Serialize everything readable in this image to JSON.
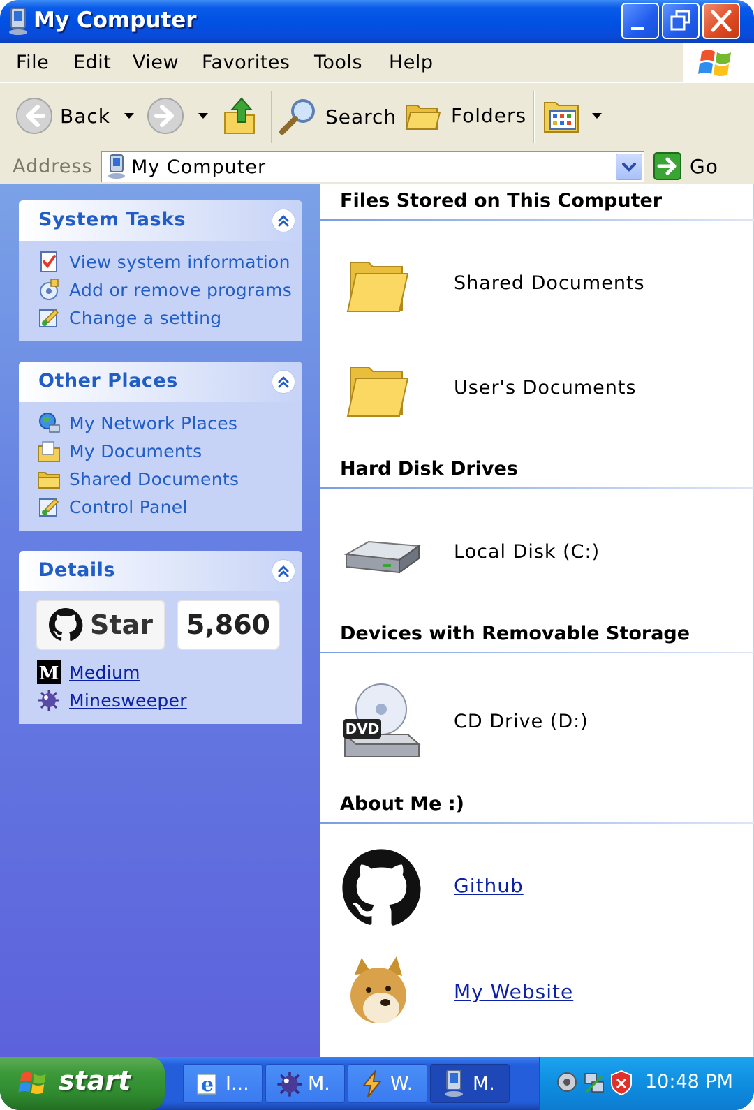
{
  "window": {
    "title": "My Computer",
    "icon": "my-computer-icon",
    "controls": [
      "minimize-icon",
      "restore-icon",
      "close-icon"
    ]
  },
  "menubar": {
    "items": [
      "File",
      "Edit",
      "View",
      "Favorites",
      "Tools",
      "Help"
    ],
    "logo": "windows-flag-logo"
  },
  "toolbar": {
    "back_label": "Back",
    "search_label": "Search",
    "folders_label": "Folders",
    "icons": [
      "back-arrow-icon",
      "forward-arrow-icon",
      "up-folder-icon",
      "search-magnifier-icon",
      "folders-icon",
      "views-icon"
    ]
  },
  "address": {
    "label": "Address",
    "value": "My Computer",
    "go_label": "Go"
  },
  "sidebar": {
    "system_tasks": {
      "title": "System Tasks",
      "items": [
        {
          "label": "View system information",
          "icon": "system-info-icon"
        },
        {
          "label": "Add or remove programs",
          "icon": "add-remove-programs-icon"
        },
        {
          "label": "Change a setting",
          "icon": "control-panel-icon"
        }
      ]
    },
    "other_places": {
      "title": "Other Places",
      "items": [
        {
          "label": "My Network Places",
          "icon": "network-places-icon"
        },
        {
          "label": "My Documents",
          "icon": "my-documents-icon"
        },
        {
          "label": "Shared Documents",
          "icon": "folder-icon"
        },
        {
          "label": "Control Panel",
          "icon": "control-panel-icon"
        }
      ]
    },
    "details": {
      "title": "Details",
      "star_label": "Star",
      "star_count": "5,860",
      "links": [
        {
          "label": "Medium",
          "icon": "medium-logo-icon"
        },
        {
          "label": "Minesweeper",
          "icon": "minesweeper-mine-icon"
        }
      ]
    }
  },
  "main": {
    "sections": [
      {
        "title": "Files Stored on This Computer",
        "items": [
          "Shared Documents",
          "User's Documents"
        ]
      },
      {
        "title": "Hard Disk Drives",
        "items": [
          "Local Disk (C:)"
        ]
      },
      {
        "title": "Devices with Removable Storage",
        "items": [
          "CD Drive (D:)"
        ]
      },
      {
        "title": "About Me :)",
        "items": [
          "Github",
          "My Website"
        ]
      }
    ],
    "dvd_badge": "DVD"
  },
  "taskbar": {
    "start_label": "start",
    "buttons": [
      {
        "label": "I...",
        "icon": "internet-explorer-icon"
      },
      {
        "label": "M.",
        "icon": "minesweeper-mine-icon"
      },
      {
        "label": "W.",
        "icon": "winamp-icon"
      },
      {
        "label": "M.",
        "icon": "my-computer-icon"
      }
    ],
    "tray_icons": [
      "volume-icon",
      "network-icon",
      "security-shield-icon"
    ],
    "clock": "10:48 PM"
  },
  "colors": {
    "title_blue": "#0052e4",
    "sidebar_link": "#215dc6",
    "hyperlink": "#0b22a8",
    "start_green": "#3c9a3a",
    "tray_blue": "#0f8ee0"
  }
}
